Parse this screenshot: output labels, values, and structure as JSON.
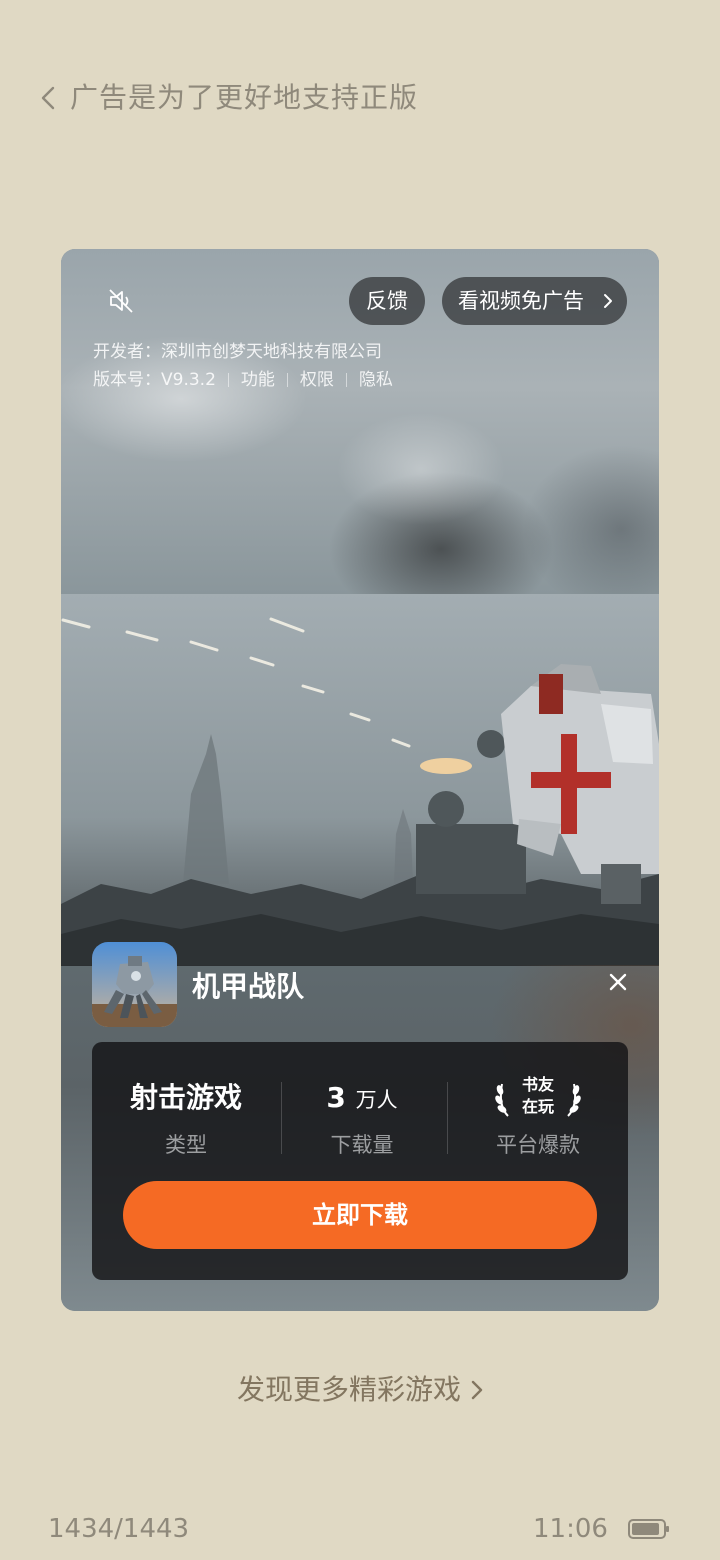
{
  "header": {
    "title": "广告是为了更好地支持正版"
  },
  "ad": {
    "feedback_label": "反馈",
    "no_ad_label": "看视频免广告",
    "developer_row": "开发者：深圳市创梦天地科技有限公司",
    "version_label": "版本号：V9.3.2",
    "links": [
      "功能",
      "权限",
      "隐私"
    ],
    "app_name": "机甲战队",
    "stats": {
      "genre_value": "射击游戏",
      "genre_label": "类型",
      "downloads_number": "3",
      "downloads_unit": "万人",
      "downloads_label": "下载量",
      "badge_line1": "书友",
      "badge_line2": "在玩",
      "badge_label": "平台爆款"
    },
    "download_label": "立即下载"
  },
  "discover_label": "发现更多精彩游戏",
  "status": {
    "page_count": "1434/1443",
    "time": "11:06"
  },
  "colors": {
    "background": "#e0d9c4",
    "download_button": "#f56a24",
    "muted_text": "#8f897b"
  },
  "icons": [
    "back-icon",
    "mute-icon",
    "chevron-right-icon",
    "close-icon",
    "laurel-icon",
    "battery-icon"
  ]
}
